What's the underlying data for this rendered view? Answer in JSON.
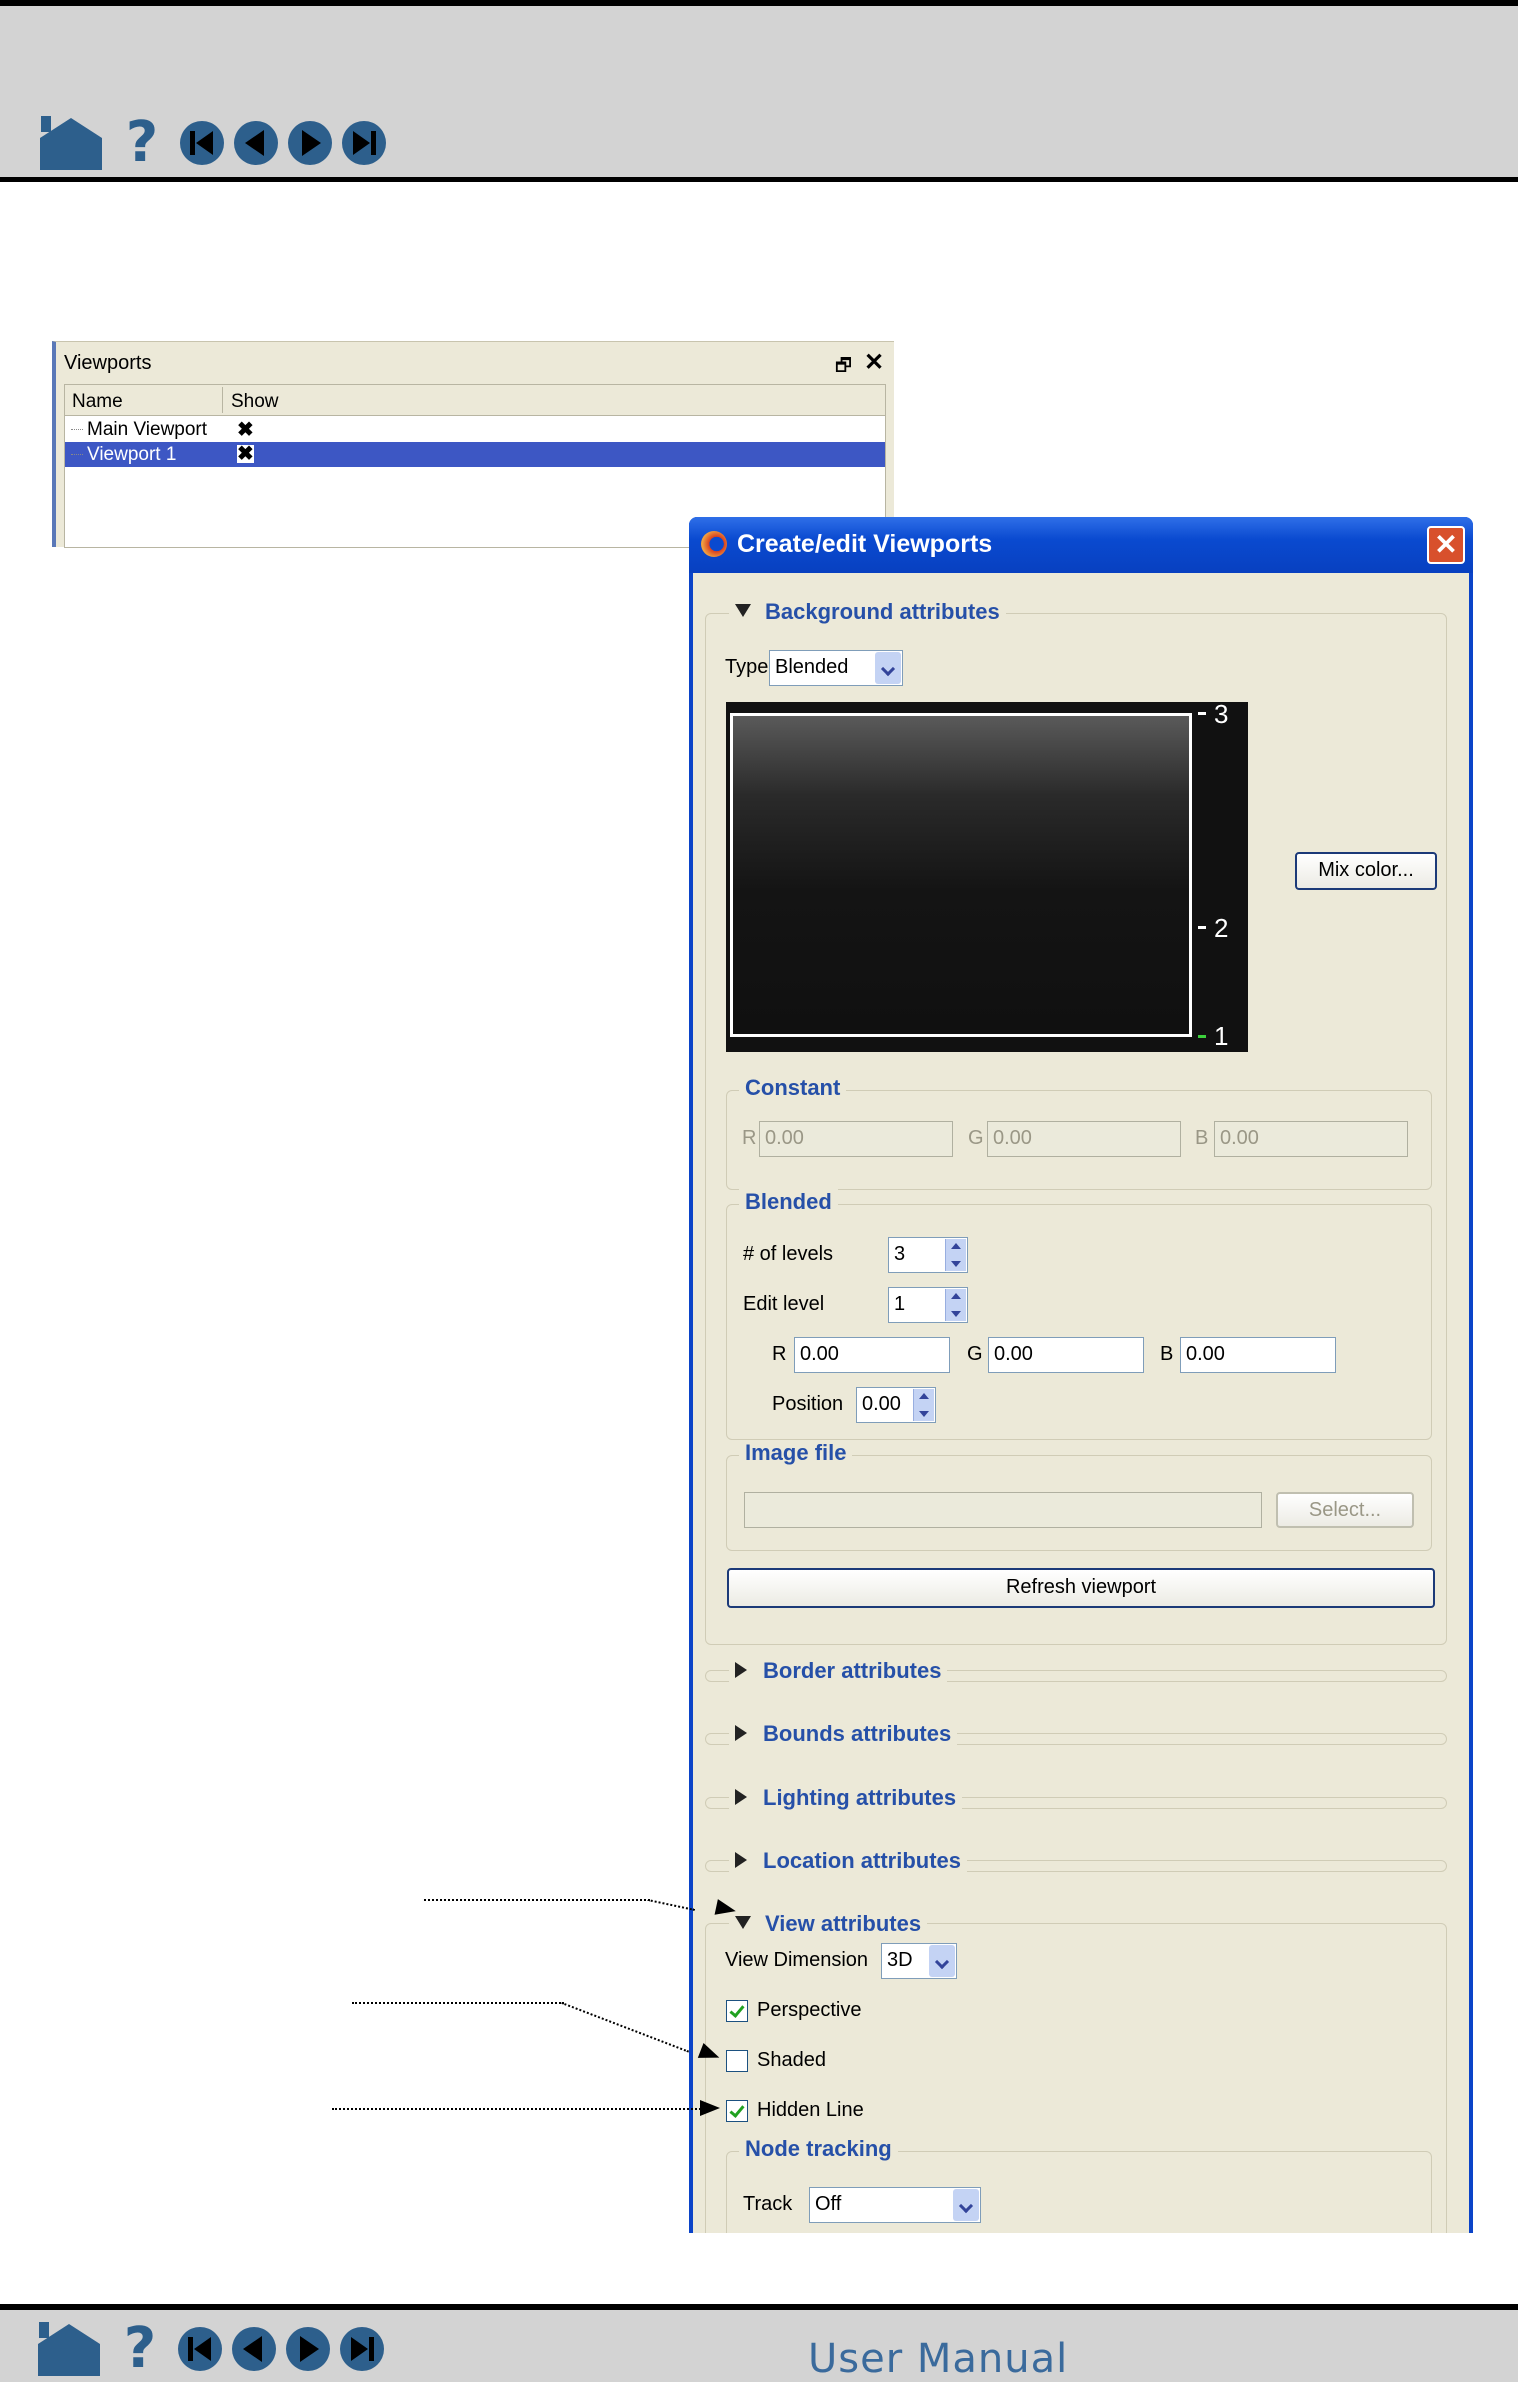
{
  "footer": {
    "title": "User Manual"
  },
  "nav_icons": [
    "home-icon",
    "help-icon",
    "first-page-icon",
    "previous-page-icon",
    "next-page-icon",
    "last-page-icon"
  ],
  "viewports_panel": {
    "title": "Viewports",
    "columns": [
      "Name",
      "Show"
    ],
    "rows": [
      {
        "name": "Main Viewport",
        "show": "✖",
        "selected": false
      },
      {
        "name": "Viewport 1",
        "show": "✖",
        "selected": true
      }
    ]
  },
  "dialog": {
    "title": "Create/edit Viewports",
    "background": {
      "legend": "Background attributes",
      "type_label": "Type",
      "type_value": "Blended",
      "levels": [
        "3",
        "2",
        "1"
      ],
      "mix_color_button": "Mix color...",
      "constant": {
        "legend": "Constant",
        "r_label": "R",
        "r_value": "0.00",
        "g_label": "G",
        "g_value": "0.00",
        "b_label": "B",
        "b_value": "0.00"
      },
      "blended": {
        "legend": "Blended",
        "levels_label": "# of levels",
        "levels_value": "3",
        "edit_level_label": "Edit level",
        "edit_level_value": "1",
        "r_label": "R",
        "r_value": "0.00",
        "g_label": "G",
        "g_value": "0.00",
        "b_label": "B",
        "b_value": "0.00",
        "position_label": "Position",
        "position_value": "0.00"
      },
      "image_file": {
        "legend": "Image file",
        "path_value": "",
        "select_button": "Select..."
      },
      "refresh_button": "Refresh viewport"
    },
    "collapsed_sections": [
      "Border attributes",
      "Bounds attributes",
      "Lighting attributes",
      "Location attributes"
    ],
    "view": {
      "legend": "View attributes",
      "dimension_label": "View Dimension",
      "dimension_value": "3D",
      "perspective_label": "Perspective",
      "perspective_checked": true,
      "shaded_label": "Shaded",
      "shaded_checked": false,
      "hidden_line_label": "Hidden Line",
      "hidden_line_checked": true,
      "node_tracking": {
        "legend": "Node tracking",
        "track_label": "Track",
        "track_value": "Off"
      }
    }
  }
}
